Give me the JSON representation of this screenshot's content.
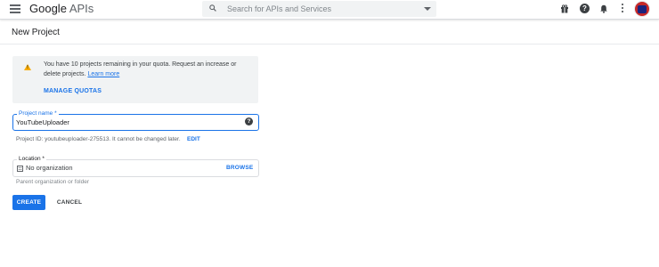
{
  "header": {
    "logo_google": "Google",
    "logo_apis": "APIs",
    "search_placeholder": "Search for APIs and Services",
    "icons": [
      "menu-icon",
      "search-icon",
      "dropdown-arrow-icon",
      "gift-icon",
      "help-icon",
      "notifications-bell-icon",
      "more-vert-icon",
      "avatar"
    ]
  },
  "page": {
    "title": "New Project"
  },
  "quota_notice": {
    "text": "You have 10 projects remaining in your quota. Request an increase or delete projects.",
    "learn_more": "Learn more",
    "manage_label": "MANAGE QUOTAS",
    "icon": "warning-icon"
  },
  "project_name": {
    "label": "Project name *",
    "value": "YouTubeUploader",
    "help_icon": "help-icon"
  },
  "project_id": {
    "text": "Project ID: youtubeuploader-275513. It cannot be changed later.",
    "edit_label": "EDIT"
  },
  "location": {
    "label": "Location *",
    "value": "No organization",
    "browse_label": "BROWSE",
    "help_text": "Parent organization or folder",
    "icon": "organization-icon"
  },
  "actions": {
    "create_label": "CREATE",
    "cancel_label": "CANCEL"
  },
  "colors": {
    "primary": "#1a73e8",
    "warning": "#f9ab00",
    "notice_bg": "#f1f3f4",
    "text": "#202124"
  }
}
